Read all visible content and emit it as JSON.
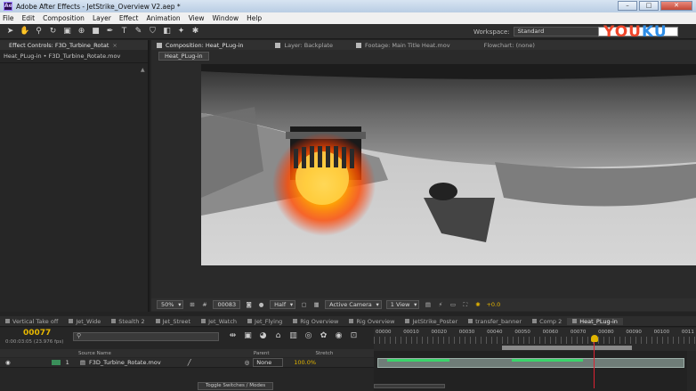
{
  "window": {
    "title": "Adobe After Effects - JetStrike_Overview V2.aep *",
    "app_icon": "Ae",
    "buttons": [
      "–",
      "□",
      "✕"
    ]
  },
  "menu": [
    "File",
    "Edit",
    "Composition",
    "Layer",
    "Effect",
    "Animation",
    "View",
    "Window",
    "Help"
  ],
  "toolbar": {
    "tools": [
      "selection-tool",
      "hand-tool",
      "zoom-tool",
      "rotate-tool",
      "camera-tool",
      "pan-behind-tool",
      "mask-tool",
      "pen-tool",
      "type-tool",
      "brush-tool",
      "clone-stamp-tool",
      "eraser-tool",
      "roto-brush-tool",
      "puppet-tool"
    ],
    "workspace_label": "Workspace:",
    "workspace_value": "Standard"
  },
  "watermark": {
    "text_a": "YOU",
    "text_b": "KU"
  },
  "left_panel": {
    "tab_label": "Effect Controls: F3D_Turbine_Rotat",
    "breadcrumb": "Heat_PLug-in • F3D_Turbine_Rotate.mov"
  },
  "comp_panel": {
    "tabs": [
      "Composition: Heat_PLug-in",
      "Layer: Backplate",
      "Footage: Main Title Heat.mov",
      "Flowchart: (none)"
    ],
    "subtab": "Heat_PLug-in",
    "viewer_bar": {
      "zoom": "50%",
      "timecode": "00083",
      "resolution": "Half",
      "camera": "Active Camera",
      "views": "1 View",
      "exposure": "+0.0"
    }
  },
  "timeline_tabs": [
    "Vertical Take off",
    "Jet_Wide",
    "Stealth 2",
    "Jet_Street",
    "Jet_Watch",
    "Jet_Flying",
    "Rig Overview",
    "Rig Overview",
    "JetStrike_Poster",
    "transfer_banner",
    "Comp 2",
    "Heat_PLug-in"
  ],
  "timeline": {
    "timecode": "00077",
    "timecode_sub": "0:00:03:05 (23.976 fps)",
    "column_headers": [
      "Source Name",
      "Parent",
      "Stretch"
    ],
    "ruler_labels": [
      "00000",
      "00010",
      "00020",
      "00030",
      "00040",
      "00050",
      "00060",
      "00070",
      "00080",
      "00090",
      "00100",
      "0011"
    ],
    "current_frame": 77,
    "layer": {
      "index": "1",
      "name": "F3D_Turbine_Rotate.mov",
      "parent": "None",
      "stretch": "100.0%"
    },
    "toggle_label": "Toggle Switches / Modes"
  }
}
